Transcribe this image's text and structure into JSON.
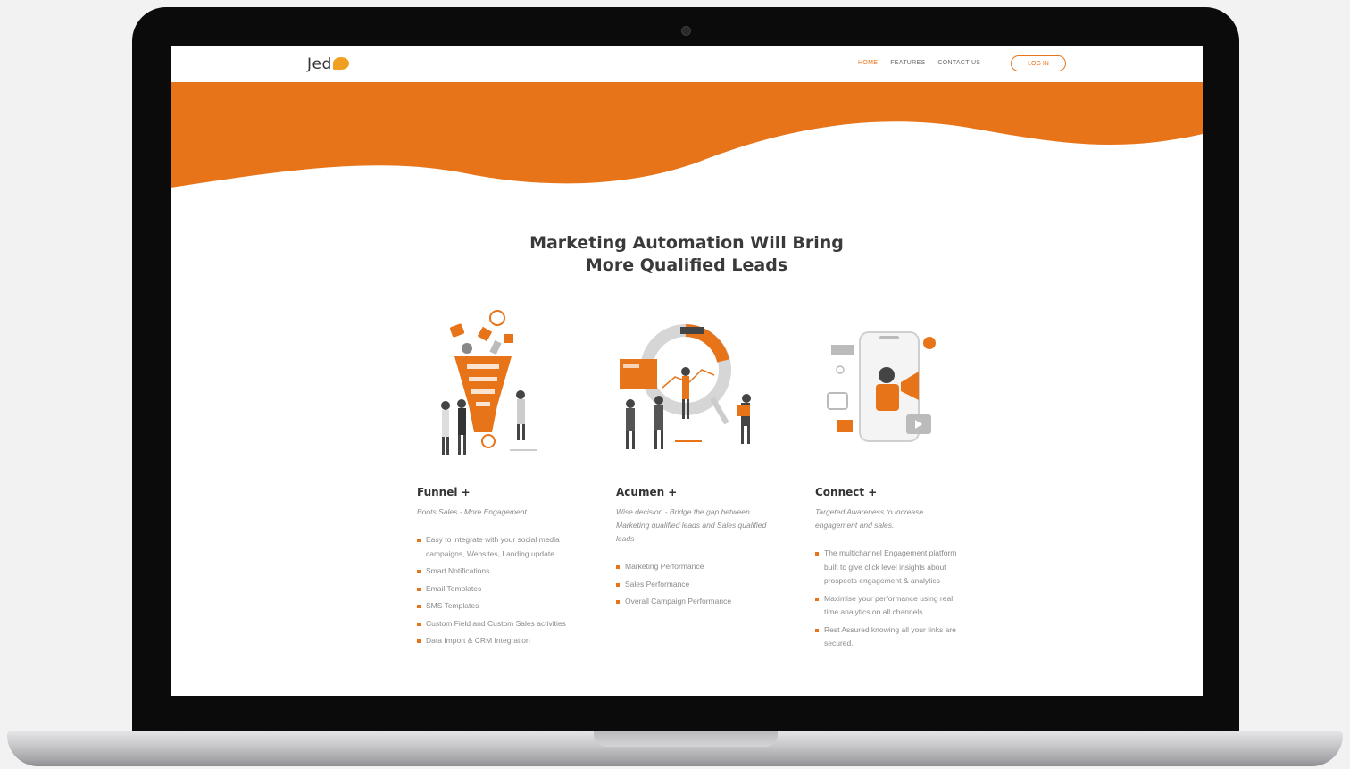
{
  "brand": {
    "logo_text": "Jed",
    "accent": "#e8741a"
  },
  "nav": {
    "links": [
      {
        "label": "HOME",
        "active": true
      },
      {
        "label": "FEATURES",
        "active": false
      },
      {
        "label": "CONTACT US",
        "active": false
      }
    ],
    "login_label": "LOG IN"
  },
  "hero": {
    "headline_line1": "Marketing Automation Will Bring",
    "headline_line2": "More Qualified Leads"
  },
  "features": [
    {
      "title": "Funnel +",
      "subtitle": "Boots Sales - More Engagement",
      "illustration": "funnel-illustration",
      "items": [
        "Easy to integrate with your social media campaigns, Websites, Landing update",
        "Smart Notifications",
        "Email Templates",
        "SMS Templates",
        "Custom Field and Custom Sales activities",
        "Data Import & CRM Integration"
      ]
    },
    {
      "title": "Acumen +",
      "subtitle": "Wise decision - Bridge the gap between Marketing qualified leads and Sales qualified leads",
      "illustration": "analytics-illustration",
      "items": [
        "Marketing Performance",
        "Sales Performance",
        "Overall Campaign Performance"
      ]
    },
    {
      "title": "Connect +",
      "subtitle": "Targeted Awareness to increase engagement and sales.",
      "illustration": "phone-megaphone-illustration",
      "items": [
        "The multichannel Engagement platform built to give click level insights about prospects engagement & analytics",
        "Maximise your performance using real time analytics on all channels",
        "Rest Assured knowing all your links are secured."
      ]
    }
  ]
}
